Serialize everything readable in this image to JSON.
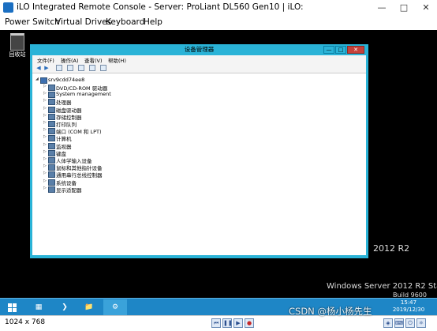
{
  "ilo": {
    "title": "iLO Integrated Remote Console - Server: ProLiant DL560 Gen10 | iLO:",
    "menus": [
      "Power Switch",
      "Virtual Drives",
      "Keyboard",
      "Help"
    ],
    "status_resolution": "1024 x 768"
  },
  "desktop": {
    "recycle_label": "回收站",
    "watermark_partial": "2012 R2",
    "os_line1": "Windows Server 2012 R2 Standard",
    "os_line2": "Build 9600"
  },
  "device_manager": {
    "title": "设备管理器",
    "menus": [
      "文件(F)",
      "操作(A)",
      "查看(V)",
      "帮助(H)"
    ],
    "root": "srv9cdd74ee8",
    "items": [
      "DVD/CD-ROM 驱动器",
      "System management",
      "处理器",
      "磁盘驱动器",
      "存储控制器",
      "打印队列",
      "端口 (COM 和 LPT)",
      "计算机",
      "监视器",
      "键盘",
      "人体学输入设备",
      "鼠标和其他指针设备",
      "通用串行总线控制器",
      "系统设备",
      "显示适配器"
    ]
  },
  "taskbar": {
    "time": "15:47",
    "date": "2019/12/30"
  },
  "overlay": {
    "csdn_watermark": "CSDN @杨小杨先生"
  },
  "colors": {
    "window_frame": "#2ab3d7",
    "taskbar": "#1e86c6",
    "close_button": "#c6413a"
  }
}
